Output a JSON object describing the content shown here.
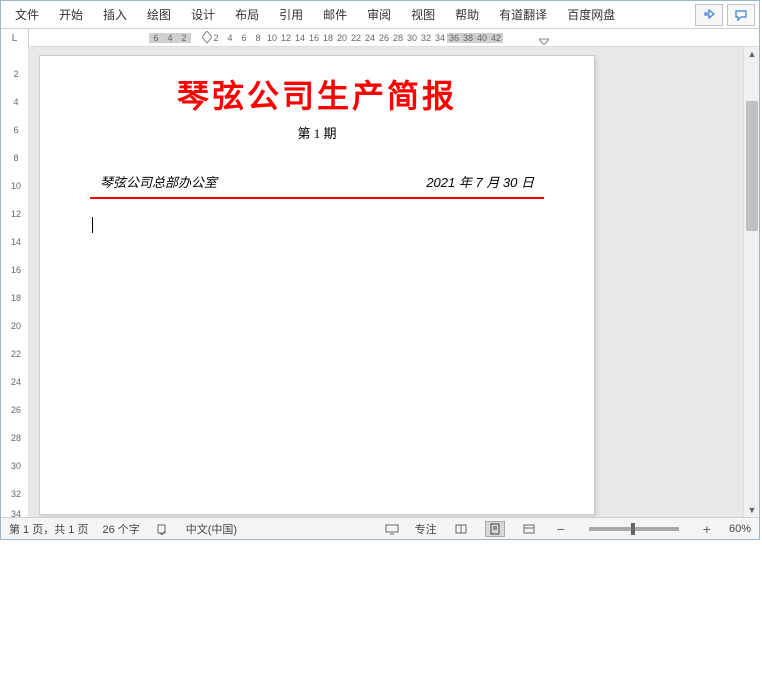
{
  "menu": {
    "items": [
      "文件",
      "开始",
      "插入",
      "绘图",
      "设计",
      "布局",
      "引用",
      "邮件",
      "审阅",
      "视图",
      "帮助",
      "有道翻译",
      "百度网盘"
    ]
  },
  "ruler": {
    "corner": "L",
    "h_ticks_left": [
      "6",
      "4",
      "2"
    ],
    "h_ticks_right": [
      "2",
      "4",
      "6",
      "8",
      "10",
      "12",
      "14",
      "16",
      "18",
      "20",
      "22",
      "24",
      "26",
      "28",
      "30",
      "32",
      "34",
      "36",
      "38",
      "40",
      "42"
    ],
    "v_ticks": [
      "2",
      "4",
      "6",
      "8",
      "10",
      "12",
      "14",
      "16",
      "18",
      "20",
      "22",
      "24",
      "26",
      "28",
      "30",
      "32",
      "34"
    ]
  },
  "doc": {
    "title": "琴弦公司生产简报",
    "issue": "第 1 期",
    "office": "琴弦公司总部办公室",
    "date": "2021 年 7 月 30 日"
  },
  "status": {
    "page": "第 1 页，共 1 页",
    "chars": "26 个字",
    "lang": "中文(中国)",
    "focus": "专注",
    "zoom": "60%"
  }
}
